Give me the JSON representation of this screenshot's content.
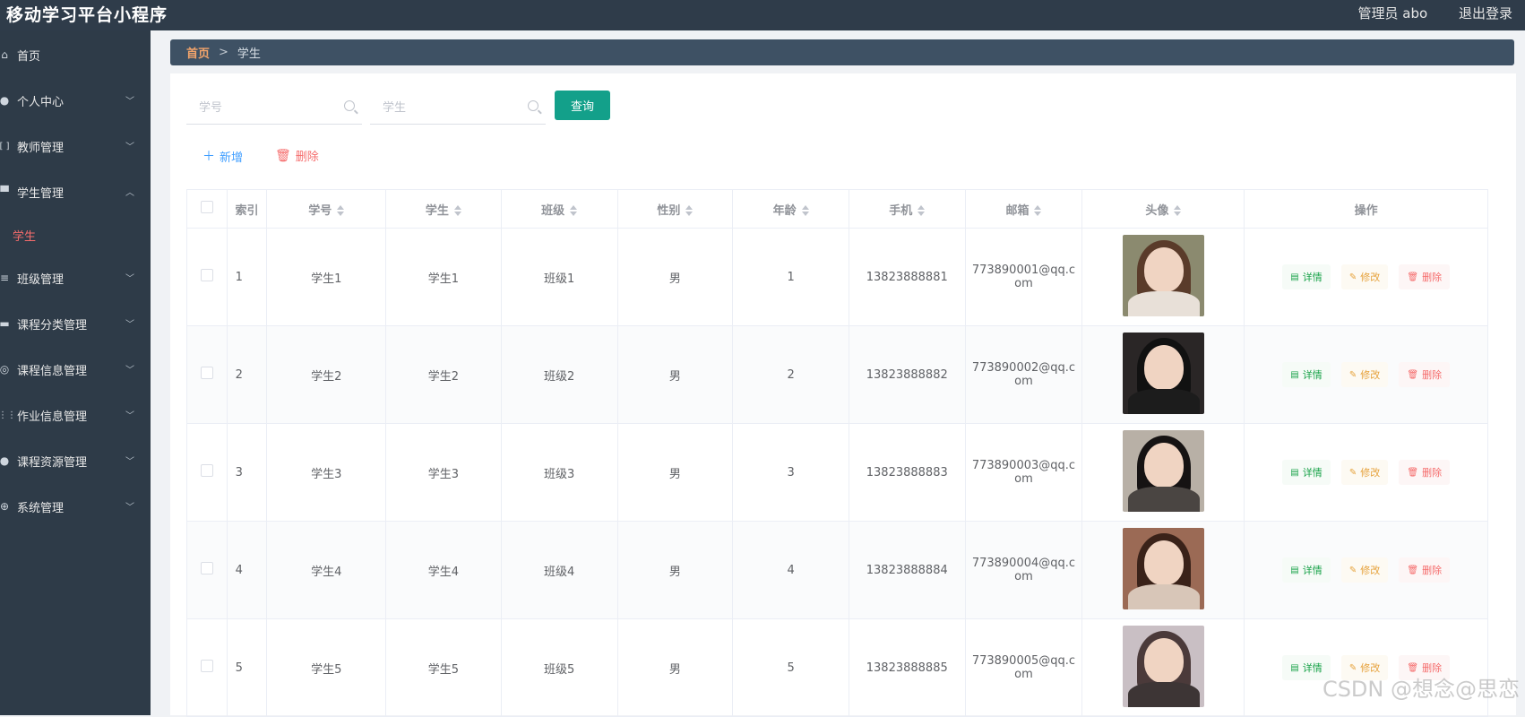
{
  "header": {
    "title": "移动学习平台小程序",
    "user": "管理员 abo",
    "logout": "退出登录"
  },
  "sidebar": {
    "items": [
      {
        "label": "首页",
        "icon": "home-icon",
        "glyph": "⌂",
        "expandable": false
      },
      {
        "label": "个人中心",
        "icon": "user-icon",
        "glyph": "●",
        "expandable": true
      },
      {
        "label": "教师管理",
        "icon": "bracket-icon",
        "glyph": "[ ]",
        "expandable": true
      },
      {
        "label": "学生管理",
        "icon": "grid-icon",
        "glyph": "▀",
        "expandable": true,
        "expanded": true
      },
      {
        "label": "学生",
        "sub": true
      },
      {
        "label": "班级管理",
        "icon": "sliders-icon",
        "glyph": "≡",
        "expandable": true
      },
      {
        "label": "课程分类管理",
        "icon": "monitor-icon",
        "glyph": "▬",
        "expandable": true
      },
      {
        "label": "课程信息管理",
        "icon": "circle-icon",
        "glyph": "◎",
        "expandable": true
      },
      {
        "label": "作业信息管理",
        "icon": "apps-icon",
        "glyph": "⋮⋮",
        "expandable": true
      },
      {
        "label": "课程资源管理",
        "icon": "location-icon",
        "glyph": "●",
        "expandable": true
      },
      {
        "label": "系统管理",
        "icon": "settings-icon",
        "glyph": "⊕",
        "expandable": true
      }
    ]
  },
  "breadcrumb": {
    "home": "首页",
    "separator": ">",
    "current": "学生"
  },
  "search": {
    "student_no_placeholder": "学号",
    "student_name_placeholder": "学生",
    "query_label": "查询"
  },
  "actions": {
    "add": "新增",
    "delete": "删除"
  },
  "table": {
    "headers": {
      "index": "索引",
      "student_no": "学号",
      "student": "学生",
      "class": "班级",
      "gender": "性别",
      "age": "年龄",
      "phone": "手机",
      "email": "邮箱",
      "avatar": "头像",
      "ops": "操作"
    },
    "row_actions": {
      "detail": "详情",
      "edit": "修改",
      "delete": "删除"
    },
    "rows": [
      {
        "index": "1",
        "student_no": "学生1",
        "student": "学生1",
        "class": "班级1",
        "gender": "男",
        "age": "1",
        "phone": "13823888881",
        "email_a": "773890001@qq.c",
        "email_b": "om",
        "avatar_colors": {
          "bg": "#8b8a6f",
          "hair": "#5a3b2a",
          "body": "#e8e0d8"
        }
      },
      {
        "index": "2",
        "student_no": "学生2",
        "student": "学生2",
        "class": "班级2",
        "gender": "男",
        "age": "2",
        "phone": "13823888882",
        "email_a": "773890002@qq.c",
        "email_b": "om",
        "avatar_colors": {
          "bg": "#2a2626",
          "hair": "#111111",
          "body": "#1c1c1c"
        }
      },
      {
        "index": "3",
        "student_no": "学生3",
        "student": "学生3",
        "class": "班级3",
        "gender": "男",
        "age": "3",
        "phone": "13823888883",
        "email_a": "773890003@qq.c",
        "email_b": "om",
        "avatar_colors": {
          "bg": "#b8b0a6",
          "hair": "#161313",
          "body": "#4a4542"
        }
      },
      {
        "index": "4",
        "student_no": "学生4",
        "student": "学生4",
        "class": "班级4",
        "gender": "男",
        "age": "4",
        "phone": "13823888884",
        "email_a": "773890004@qq.c",
        "email_b": "om",
        "avatar_colors": {
          "bg": "#9b6a55",
          "hair": "#3a2219",
          "body": "#d8c6b8"
        }
      },
      {
        "index": "5",
        "student_no": "学生5",
        "student": "学生5",
        "class": "班级5",
        "gender": "男",
        "age": "5",
        "phone": "13823888885",
        "email_a": "773890005@qq.c",
        "email_b": "om",
        "avatar_colors": {
          "bg": "#c9bfc4",
          "hair": "#4b3a3a",
          "body": "#3d3535"
        }
      }
    ]
  },
  "watermark": "CSDN @想念@思恋",
  "colors": {
    "topbar": "#2f3c4a",
    "sidebar": "#2e3b48",
    "accent": "#13a08a",
    "active_sub": "#f56c6c",
    "breadcrumb_home": "#f2a46b"
  }
}
